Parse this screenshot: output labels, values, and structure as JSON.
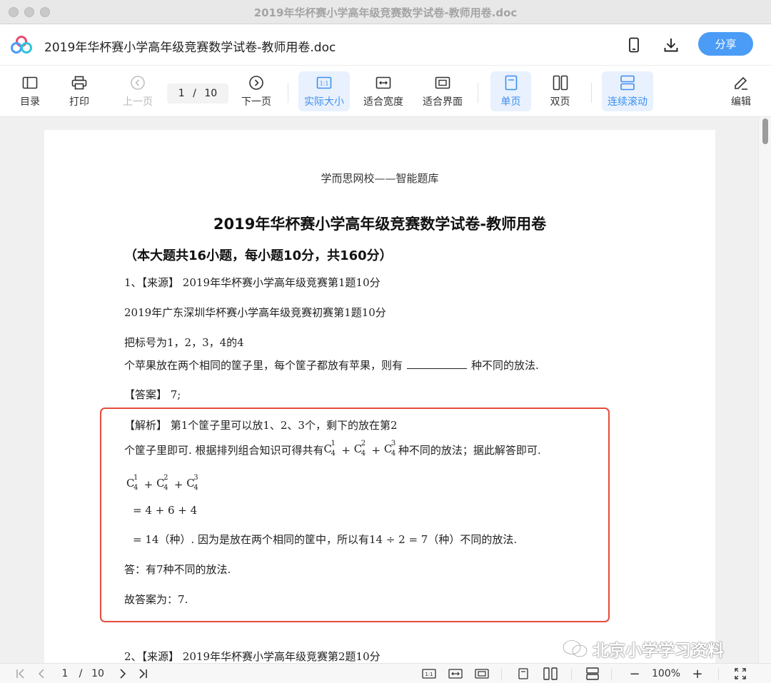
{
  "window": {
    "title": "2019年华杯赛小学高年级竞赛数学试卷-教师用卷.doc"
  },
  "header": {
    "doc_title": "2019年华杯赛小学高年级竞赛数学试卷-教师用卷.doc",
    "share_label": "分享",
    "icons": [
      "phone-icon",
      "download-icon"
    ]
  },
  "toolbar": {
    "toc": "目录",
    "print": "打印",
    "prev": "上一页",
    "page_current": "1",
    "page_sep": "/",
    "page_total": "10",
    "next": "下一页",
    "actual_size": "实际大小",
    "fit_width": "适合宽度",
    "fit_screen": "适合界面",
    "single": "单页",
    "double": "双页",
    "continuous": "连续滚动",
    "edit": "编辑"
  },
  "document": {
    "header_line": "学而思网校——智能题库",
    "title": "2019年华杯赛小学高年级竞赛数学试卷-教师用卷",
    "section": "（本大题共16小题，每小题10分，共160分）",
    "q1_source": "1、【来源】 2019年华杯赛小学高年级竞赛第1题10分",
    "q1_source2": "2019年广东深圳华杯赛小学高年级竞赛初赛第1题10分",
    "q1_line1": "把标号为1，2，3，4的4",
    "q1_line2a": "个苹果放在两个相同的筐子里，每个筐子都放有苹果，则有",
    "q1_line2b": "种不同的放法.",
    "answer": "【答案】 7;",
    "analysis1": "【解析】 第1个筐子里可以放1、2、3个，剩下的放在第2",
    "analysis2a": "个筐子里即可. 根据排列组合知识可得共有",
    "analysis2b": "种不同的放法；据此解答即可.",
    "formula_eq1": "= 4 + 6 + 4",
    "formula_eq2": "= 14（种）. 因为是放在两个相同的筐中，所以有14 ÷ 2 = 7（种）不同的放法.",
    "conclusion": "答：有7种不同的放法.",
    "final": "故答案为：7.",
    "q2_source": "2、【来源】 2019年华杯赛小学高年级竞赛第2题10分",
    "comb_C": "C",
    "comb_n": "4",
    "comb_k1": "1",
    "comb_k2": "2",
    "comb_k3": "3",
    "plus": "+"
  },
  "watermark": "北京小学学习资料",
  "status": {
    "page_current": "1",
    "page_sep": "/",
    "page_total": "10",
    "zoom": "100%",
    "minus": "−",
    "plus": "+"
  },
  "colors": {
    "accent": "#4a9cf6",
    "red_box": "#e54c3c",
    "active_bg": "#e8f1fd"
  }
}
